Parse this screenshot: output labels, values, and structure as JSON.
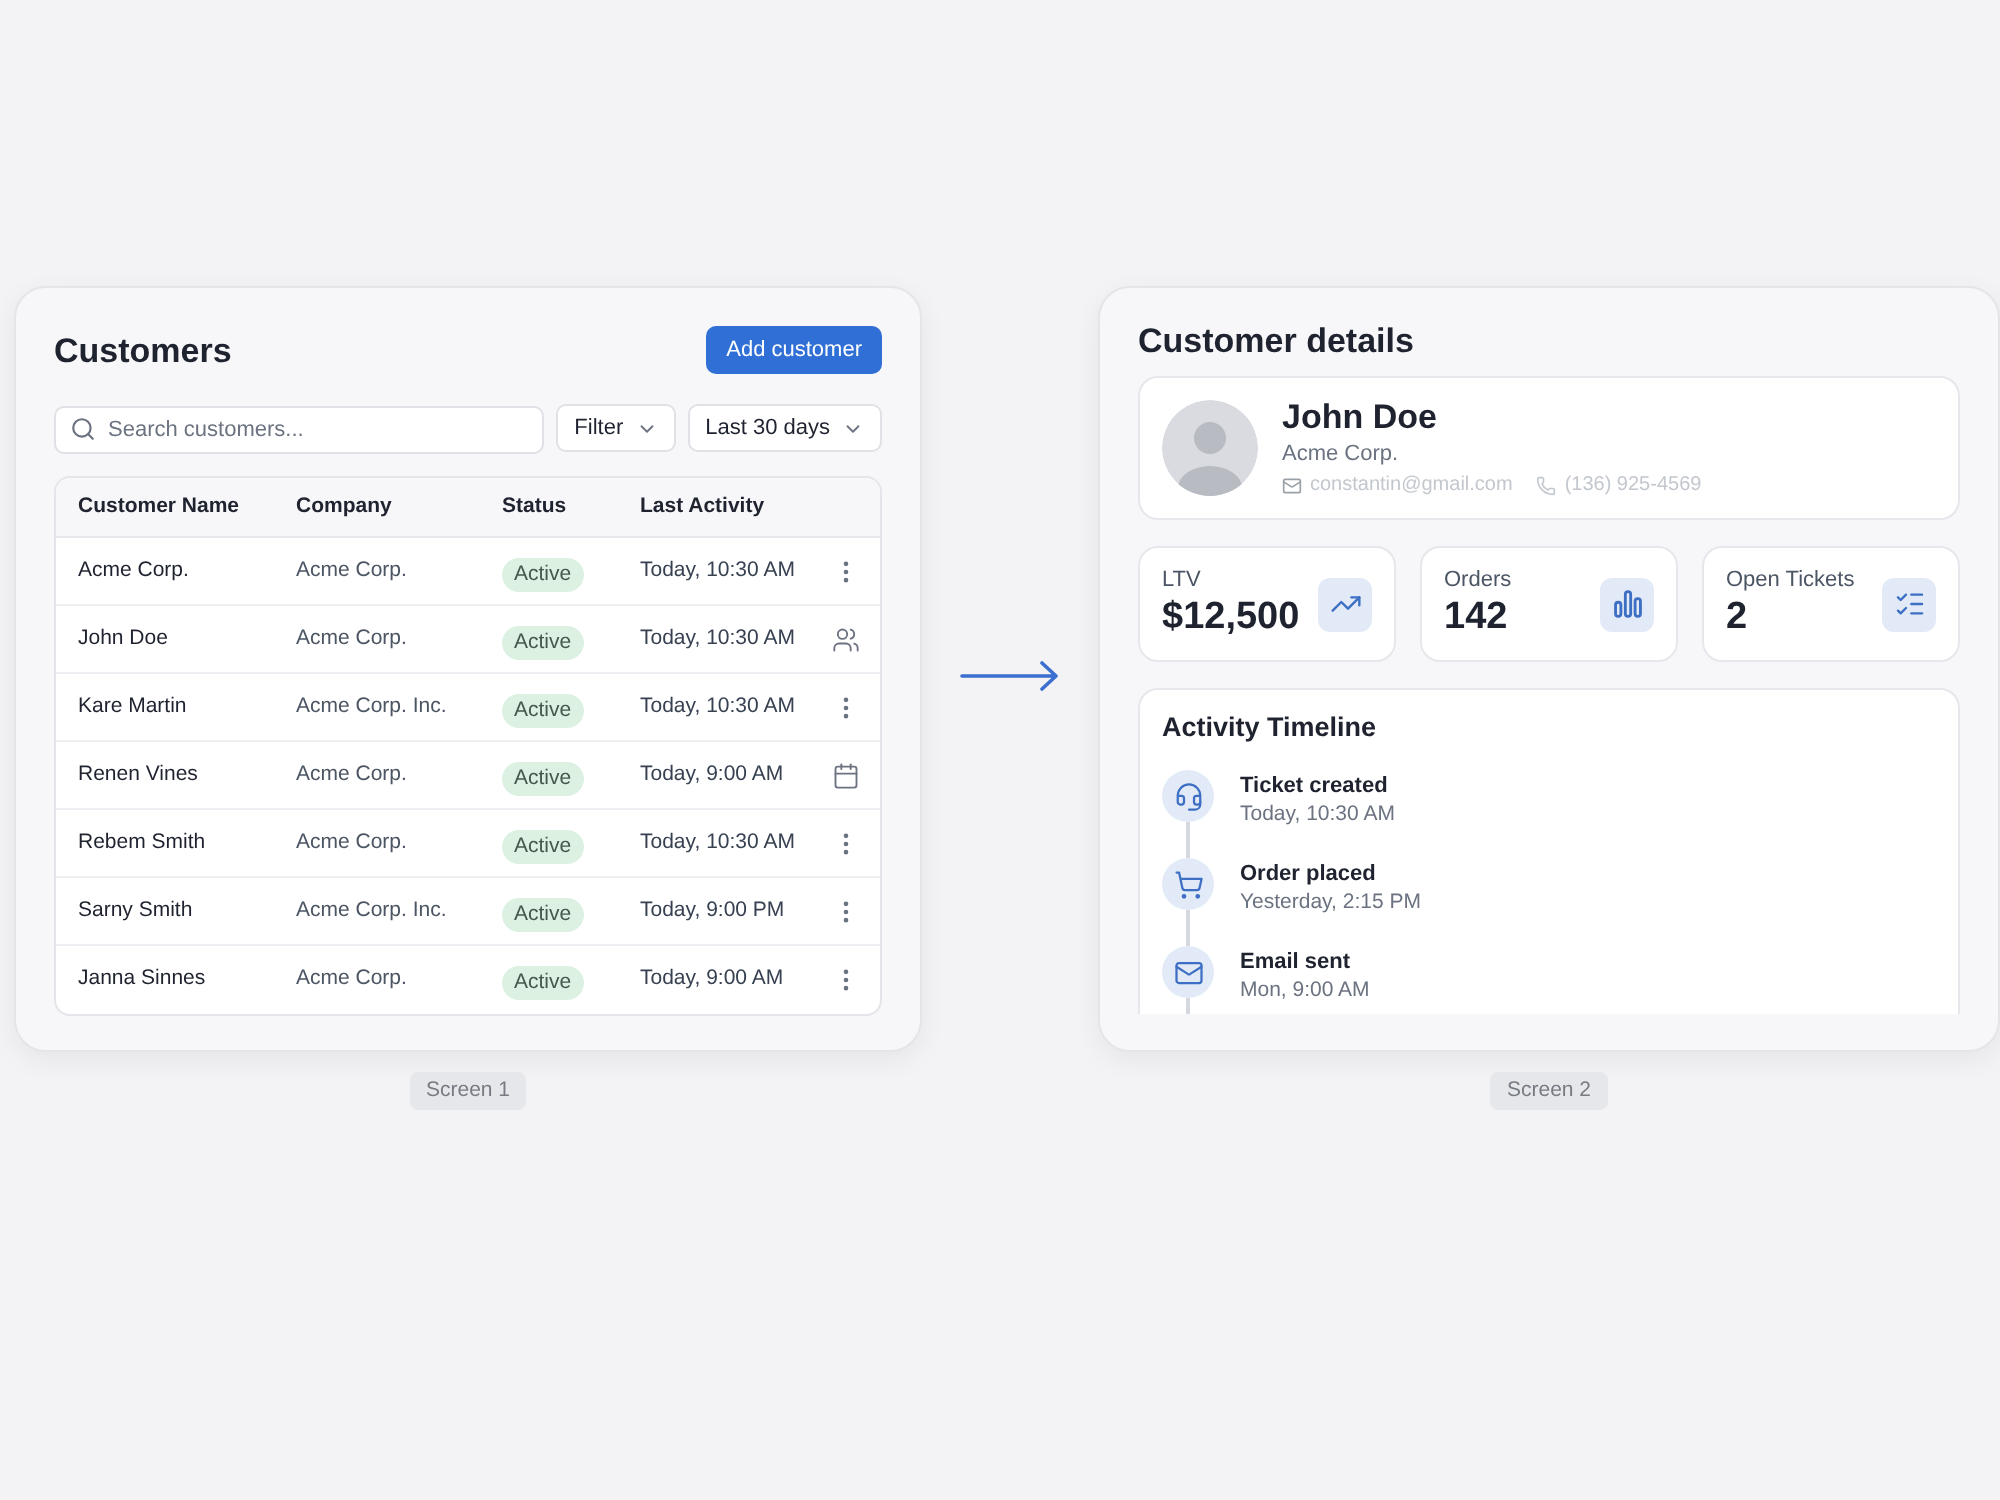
{
  "customers_screen": {
    "title": "Customers",
    "add_button": "Add customer",
    "search": {
      "placeholder": "Search customers..."
    },
    "filters": [
      "Filter",
      "Last 30 days"
    ],
    "table": {
      "columns": [
        "Customer Name",
        "Company",
        "Status",
        "Last Activity"
      ],
      "rows": [
        {
          "name": "Acme Corp.",
          "company": "Acme Corp.",
          "status": "Active",
          "last_activity": "Today, 10:30 AM",
          "kind": "menu"
        },
        {
          "name": "John Doe",
          "company": "Acme Corp.",
          "status": "Active",
          "last_activity": "Today, 10:30 AM",
          "kind": "contacts"
        },
        {
          "name": "Kare Martin",
          "company": "Acme Corp. Inc.",
          "status": "Active",
          "last_activity": "Today, 10:30 AM",
          "kind": "menu"
        },
        {
          "name": "Renen Vines",
          "company": "Acme Corp.",
          "status": "Active",
          "last_activity": "Today, 9:00 AM",
          "kind": "calendar"
        },
        {
          "name": "Rebem Smith",
          "company": "Acme Corp.",
          "status": "Active",
          "last_activity": "Today, 10:30 AM",
          "kind": "menu"
        },
        {
          "name": "Sarny Smith",
          "company": "Acme Corp. Inc.",
          "status": "Active",
          "last_activity": "Today, 9:00 PM",
          "kind": "menu"
        },
        {
          "name": "Janna Sinnes",
          "company": "Acme Corp.",
          "status": "Active",
          "last_activity": "Today, 9:00 AM",
          "kind": "menu"
        }
      ]
    },
    "label": "Screen 1"
  },
  "details_screen": {
    "title": "Customer details",
    "profile": {
      "name": "John Doe",
      "company": "Acme Corp.",
      "email": "constantin@gmail.com",
      "phone": "(136) 925-4569"
    },
    "stats": [
      {
        "label": "LTV",
        "value": "$12,500",
        "kind": "trend"
      },
      {
        "label": "Orders",
        "value": "142",
        "kind": "bars"
      },
      {
        "label": "Open Tickets",
        "value": "2",
        "kind": "checklist"
      }
    ],
    "timeline": {
      "title": "Activity Timeline",
      "items": [
        {
          "title": "Ticket created",
          "time": "Today, 10:30 AM",
          "kind": "support"
        },
        {
          "title": "Order placed",
          "time": "Yesterday, 2:15 PM",
          "kind": "order"
        },
        {
          "title": "Email sent",
          "time": "Mon, 9:00 AM",
          "kind": "email"
        }
      ]
    },
    "label": "Screen 2"
  }
}
